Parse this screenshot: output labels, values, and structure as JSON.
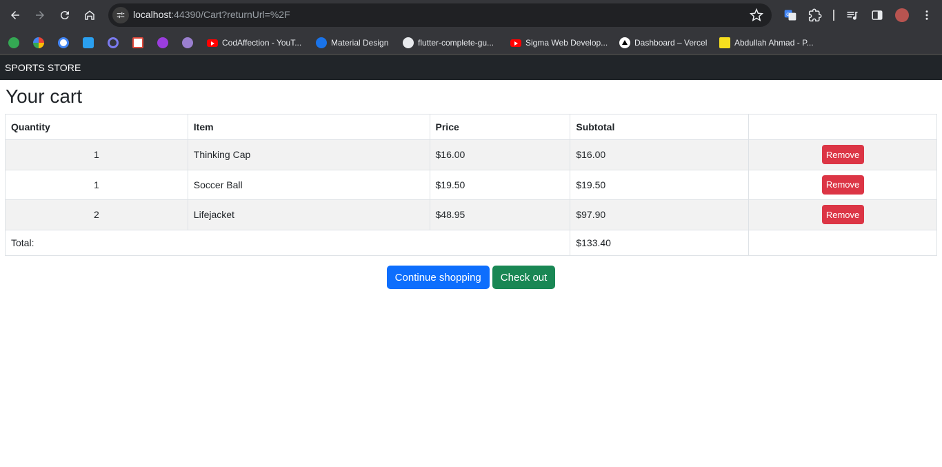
{
  "browser": {
    "url_host": "localhost",
    "url_rest": ":44390/Cart?returnUrl=%2F",
    "bookmarks": [
      {
        "label": "",
        "icon": "fi-icon",
        "color": "#34a853"
      },
      {
        "label": "",
        "icon": "dots-icon",
        "color": "#f4b400"
      },
      {
        "label": "",
        "icon": "c-icon",
        "color": "#4285f4"
      },
      {
        "label": "",
        "icon": "dart-icon",
        "color": "#2aa0f0"
      },
      {
        "label": "",
        "icon": "ring-icon",
        "color": "#5b5bd6"
      },
      {
        "label": "",
        "icon": "grid-icon",
        "color": "#e04a3c"
      },
      {
        "label": "",
        "icon": "u-icon",
        "color": "#9b3dde"
      },
      {
        "label": "",
        "icon": "avatar-icon",
        "color": "#9a7fcf"
      },
      {
        "label": "CodAffection - YouT...",
        "icon": "youtube-icon",
        "color": "#ff0000"
      },
      {
        "label": "Material Design",
        "icon": "material-icon",
        "color": "#1a73e8"
      },
      {
        "label": "flutter-complete-gu...",
        "icon": "github-icon",
        "color": "#ffffff"
      },
      {
        "label": "Sigma Web Develop...",
        "icon": "youtube-icon",
        "color": "#ff0000"
      },
      {
        "label": "Dashboard – Vercel",
        "icon": "vercel-icon",
        "color": "#000000"
      },
      {
        "label": "Abdullah Ahmad - P...",
        "icon": "ab-icon",
        "color": "#f7df1e"
      }
    ]
  },
  "navbar": {
    "brand": "SPORTS STORE"
  },
  "page": {
    "title": "Your cart"
  },
  "cart": {
    "headers": [
      "Quantity",
      "Item",
      "Price",
      "Subtotal",
      ""
    ],
    "rows": [
      {
        "quantity": "1",
        "item": "Thinking Cap",
        "price": "$16.00",
        "subtotal": "$16.00",
        "action": "Remove"
      },
      {
        "quantity": "1",
        "item": "Soccer Ball",
        "price": "$19.50",
        "subtotal": "$19.50",
        "action": "Remove"
      },
      {
        "quantity": "2",
        "item": "Lifejacket",
        "price": "$48.95",
        "subtotal": "$97.90",
        "action": "Remove"
      }
    ],
    "total_label": "Total:",
    "total_value": "$133.40"
  },
  "buttons": {
    "continue": "Continue shopping",
    "checkout": "Check out"
  },
  "colors": {
    "danger": "#dc3545",
    "primary": "#0d6efd",
    "success": "#198754",
    "navbar": "#212529"
  }
}
